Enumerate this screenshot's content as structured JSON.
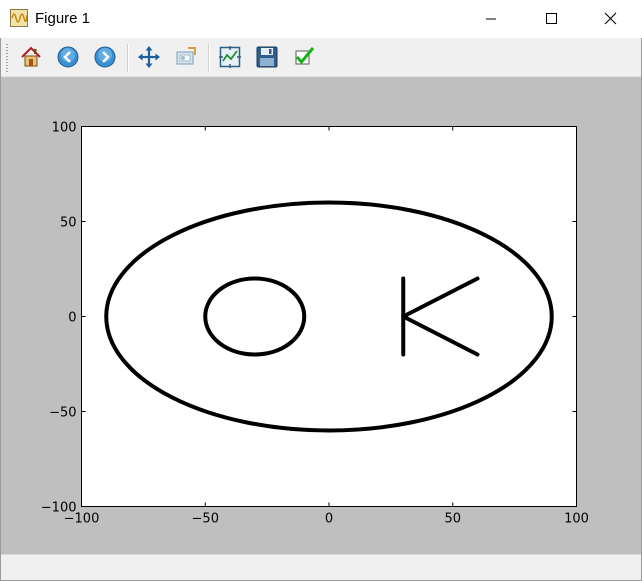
{
  "window": {
    "title": "Figure 1",
    "controls": [
      "minimize",
      "maximize",
      "close"
    ]
  },
  "toolbar": {
    "buttons": [
      {
        "name": "home",
        "icon": "home-icon"
      },
      {
        "name": "back",
        "icon": "back-arrow-icon"
      },
      {
        "name": "forward",
        "icon": "forward-arrow-icon"
      },
      {
        "name": "pan",
        "icon": "move-icon"
      },
      {
        "name": "zoom",
        "icon": "zoom-rect-icon"
      },
      {
        "name": "subplots",
        "icon": "subplots-icon"
      },
      {
        "name": "save",
        "icon": "floppy-disk-icon"
      },
      {
        "name": "edit",
        "icon": "checkmark-icon"
      }
    ]
  },
  "colors": {
    "canvas_bg": "#bfbfbf",
    "axes_bg": "#ffffff",
    "line": "#000000"
  },
  "chart_data": {
    "type": "line",
    "title": "",
    "xlabel": "",
    "ylabel": "",
    "xlim": [
      -100,
      100
    ],
    "ylim": [
      -100,
      100
    ],
    "xticks": [
      "−100",
      "−50",
      "0",
      "50",
      "100"
    ],
    "yticks": [
      "100",
      "50",
      "0",
      "−50",
      "−100"
    ],
    "grid": false,
    "series": [
      {
        "shape": "ellipse",
        "center": [
          0,
          0
        ],
        "rx": 90,
        "ry": 60
      },
      {
        "shape": "circle",
        "center": [
          -30,
          0
        ],
        "r": 20
      },
      {
        "shape": "polyline",
        "points": [
          [
            30,
            20
          ],
          [
            30,
            -20
          ]
        ]
      },
      {
        "shape": "polyline",
        "points": [
          [
            60,
            20
          ],
          [
            30,
            0
          ],
          [
            60,
            -20
          ]
        ]
      }
    ]
  }
}
